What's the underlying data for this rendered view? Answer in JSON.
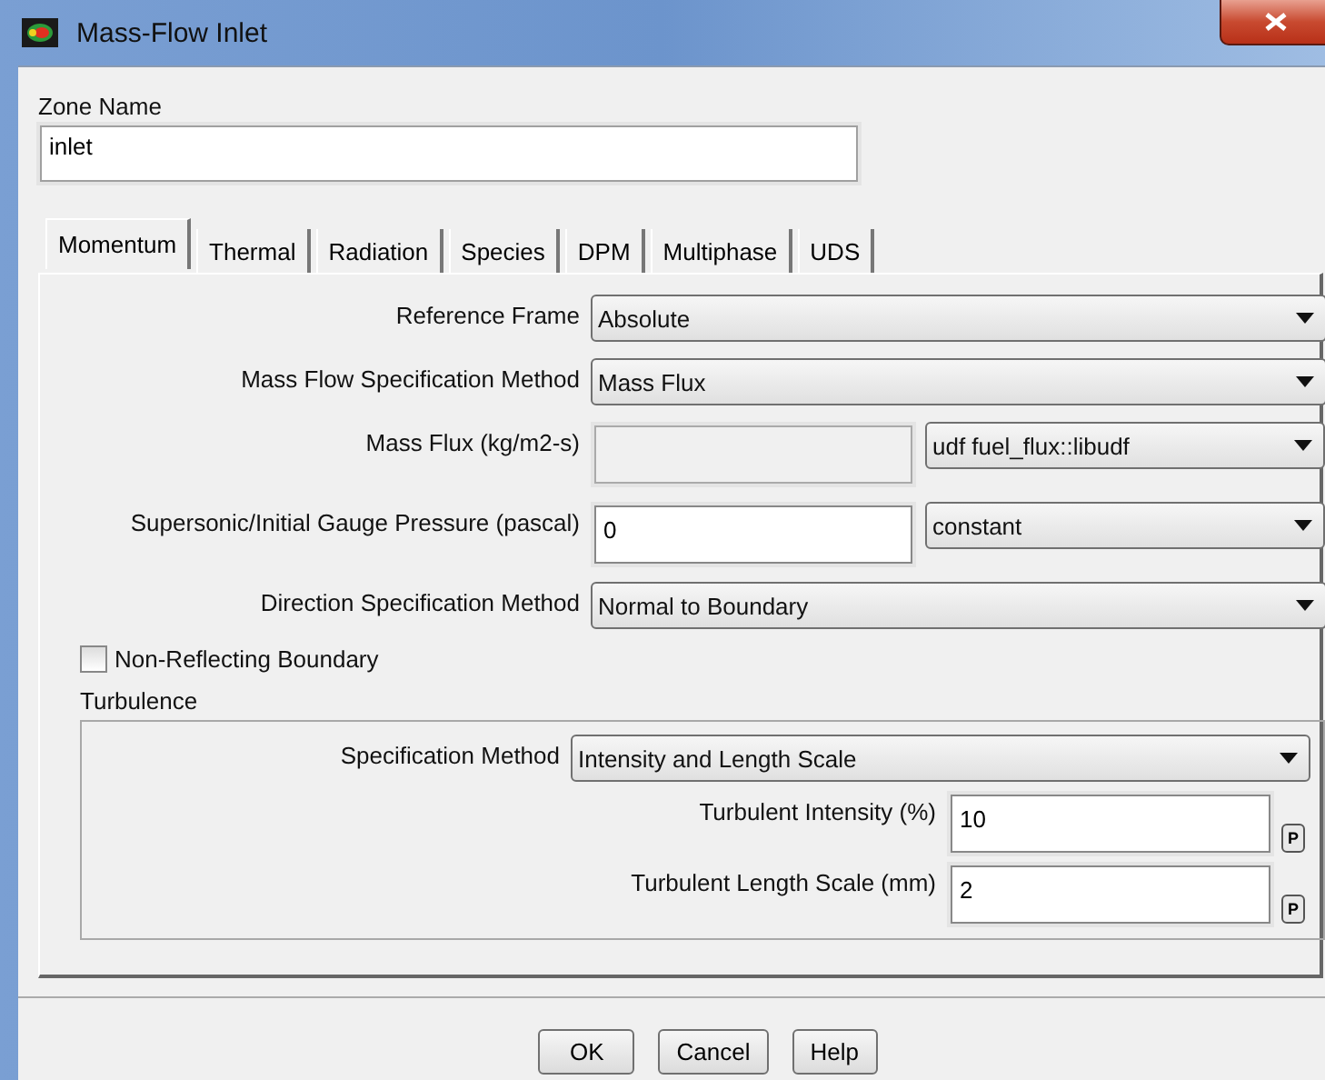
{
  "window": {
    "title": "Mass-Flow Inlet"
  },
  "zone_name": {
    "label": "Zone Name",
    "value": "inlet"
  },
  "tabs": [
    {
      "label": "Momentum",
      "selected": true
    },
    {
      "label": "Thermal",
      "selected": false
    },
    {
      "label": "Radiation",
      "selected": false
    },
    {
      "label": "Species",
      "selected": false
    },
    {
      "label": "DPM",
      "selected": false
    },
    {
      "label": "Multiphase",
      "selected": false
    },
    {
      "label": "UDS",
      "selected": false
    }
  ],
  "rows": [
    {
      "kind": "dropdown",
      "label": "Reference Frame",
      "value": "Absolute"
    },
    {
      "kind": "dropdown",
      "label": "Mass Flow Specification Method",
      "value": "Mass Flux"
    },
    {
      "kind": "field-dropdown",
      "label": "Mass Flux (kg/m2-s)",
      "field": {
        "disabled": true
      },
      "value": "udf fuel_flux::libudf"
    },
    {
      "kind": "field-dropdown",
      "label": "Supersonic/Initial Gauge Pressure (pascal)",
      "field": {
        "value": "0",
        "disabled": false
      },
      "value": "constant"
    },
    {
      "kind": "dropdown",
      "label": "Direction Specification Method",
      "value": "Normal to Boundary"
    }
  ],
  "checkbox": {
    "label": "Non-Reflecting Boundary",
    "checked": false
  },
  "turbulence": {
    "title": "Turbulence",
    "rows": [
      {
        "kind": "dropdown",
        "label": "Specification Method",
        "value": "Intensity and Length Scale"
      },
      {
        "kind": "param",
        "label": "Turbulent Intensity (%)",
        "value": "10",
        "button": "P"
      },
      {
        "kind": "param",
        "label": "Turbulent Length Scale (mm)",
        "value": "2",
        "button": "P"
      }
    ]
  },
  "buttons": [
    "OK",
    "Cancel",
    "Help"
  ]
}
